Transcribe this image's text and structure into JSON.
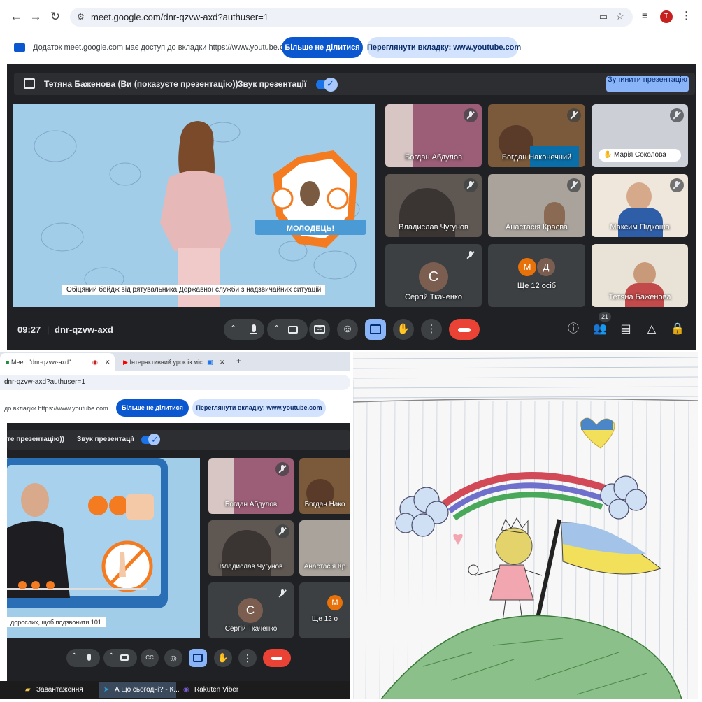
{
  "browser": {
    "url": "meet.google.com/dnr-qzvw-axd?authuser=1",
    "profile_initial": "T"
  },
  "share_banner": {
    "message": "Додаток meet.google.com має доступ до вкладки https://www.youtube.com",
    "stop_label": "Більше не ділитися",
    "view_label": "Переглянути вкладку: www.youtube.com"
  },
  "meet": {
    "presenter_text": "Тетяна Баженова (Ви (показуєте презентацію))",
    "audio_label": "Звук презентації",
    "stop_presenting": "Зупинити презентацію",
    "slide_caption": "Обіцяний бейдж від рятувальника Державної служби з надзвичайних ситуацій",
    "badge_text": "МОЛОДЕЦЬ!",
    "time": "09:27",
    "meeting_code": "dnr-qzvw-axd",
    "people_count": "21",
    "participants": [
      {
        "name": "Богдан Абдулов"
      },
      {
        "name": "Богдан Наконечний"
      },
      {
        "name": "Марія Соколова"
      },
      {
        "name": "Владислав Чугунов"
      },
      {
        "name": "Анастасія Краєва"
      },
      {
        "name": "Максим Підкоша"
      },
      {
        "name": "Сергій Ткаченко",
        "initial": "С"
      },
      {
        "name": "Ще 12 осіб",
        "initials": [
          "М",
          "Д"
        ]
      },
      {
        "name": "Тетяна Баженова"
      }
    ]
  },
  "second_screen": {
    "tab1": "Meet: \"dnr-qzvw-axd\"",
    "tab2": "Інтерактивний урок із міс",
    "url": "dnr-qzvw-axd?authuser=1",
    "banner_text": "до вкладки https://www.youtube.com",
    "presenter_fragment": "те презентацію))",
    "slide_caption": "дорослих, щоб подзвонити 101.",
    "participants": [
      {
        "name": "Богдан Абдулов"
      },
      {
        "name": "Богдан Нако"
      },
      {
        "name": "Владислав Чугунов"
      },
      {
        "name": "Анастасія Кр"
      },
      {
        "name": "Сергій Ткаченко",
        "initial": "С"
      },
      {
        "name": "Ще 12 о",
        "initials": [
          "М"
        ]
      }
    ],
    "taskbar": [
      {
        "label": "Завантаження"
      },
      {
        "label": "А що сьогодні? - К..."
      },
      {
        "label": "Rakuten Viber"
      }
    ]
  },
  "colors": {
    "meet_bg": "#202124",
    "accent_blue": "#0b57d0",
    "end_call_red": "#ea4335",
    "stage_blue": "#a2cde9"
  }
}
